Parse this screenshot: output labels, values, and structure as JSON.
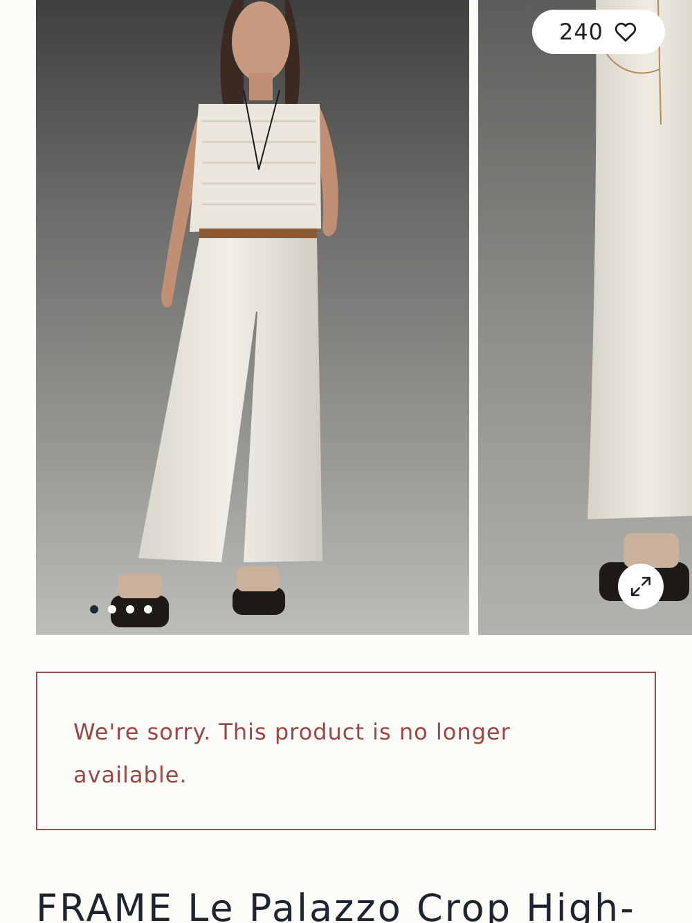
{
  "gallery": {
    "likes": {
      "count": "240",
      "icon": "heart-outline-icon"
    },
    "expand_icon": "expand-arrows-icon",
    "slides": [
      {
        "description_label": "Model wearing white cropped wide-leg jeans",
        "active": true
      },
      {
        "description_label": "Close-up of jeans leg and sandal",
        "active": false
      },
      {
        "active": false
      },
      {
        "active": false
      }
    ],
    "dot_count": 4,
    "active_dot": 0
  },
  "notice": {
    "message": "We're sorry. This product is no longer available.",
    "color": "#9b4545"
  },
  "product": {
    "title": "FRAME Le Palazzo Crop High-"
  },
  "colors": {
    "background": "#fcfcf8",
    "title": "#1c2530",
    "accent_border": "#9b4b4b",
    "active_dot": "#1f2a33"
  }
}
